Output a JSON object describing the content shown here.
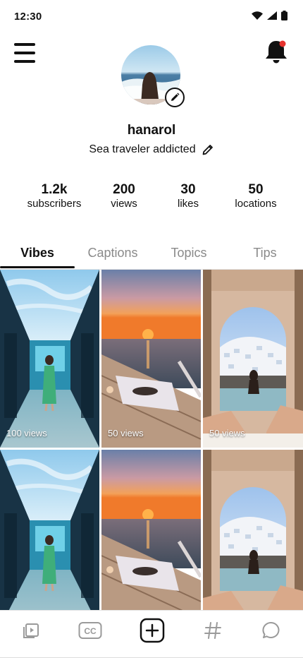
{
  "status_bar": {
    "time": "12:30"
  },
  "profile": {
    "username": "hanarol",
    "bio": "Sea traveler addicted"
  },
  "stats": [
    {
      "value": "1.2k",
      "label": "subscribers"
    },
    {
      "value": "200",
      "label": "views"
    },
    {
      "value": "30",
      "label": "likes"
    },
    {
      "value": "50",
      "label": "locations"
    }
  ],
  "tabs": [
    {
      "label": "Vibes",
      "active": true
    },
    {
      "label": "Captions",
      "active": false
    },
    {
      "label": "Topics",
      "active": false
    },
    {
      "label": "Tips",
      "active": false
    }
  ],
  "grid": [
    {
      "scene": "corridor",
      "views": "100 views"
    },
    {
      "scene": "sunset",
      "views": "50 views"
    },
    {
      "scene": "pool",
      "views": "50 views"
    },
    {
      "scene": "corridor",
      "views": ""
    },
    {
      "scene": "sunset",
      "views": ""
    },
    {
      "scene": "pool",
      "views": ""
    }
  ],
  "bottom_nav": [
    {
      "icon": "video-play-icon"
    },
    {
      "icon": "closed-captions-icon"
    },
    {
      "icon": "add-post-icon"
    },
    {
      "icon": "hashtag-icon"
    },
    {
      "icon": "chat-bubble-icon"
    }
  ],
  "colors": {
    "notification_dot": "#e5322d",
    "text_primary": "#111111",
    "text_muted": "#8a8a8a"
  }
}
